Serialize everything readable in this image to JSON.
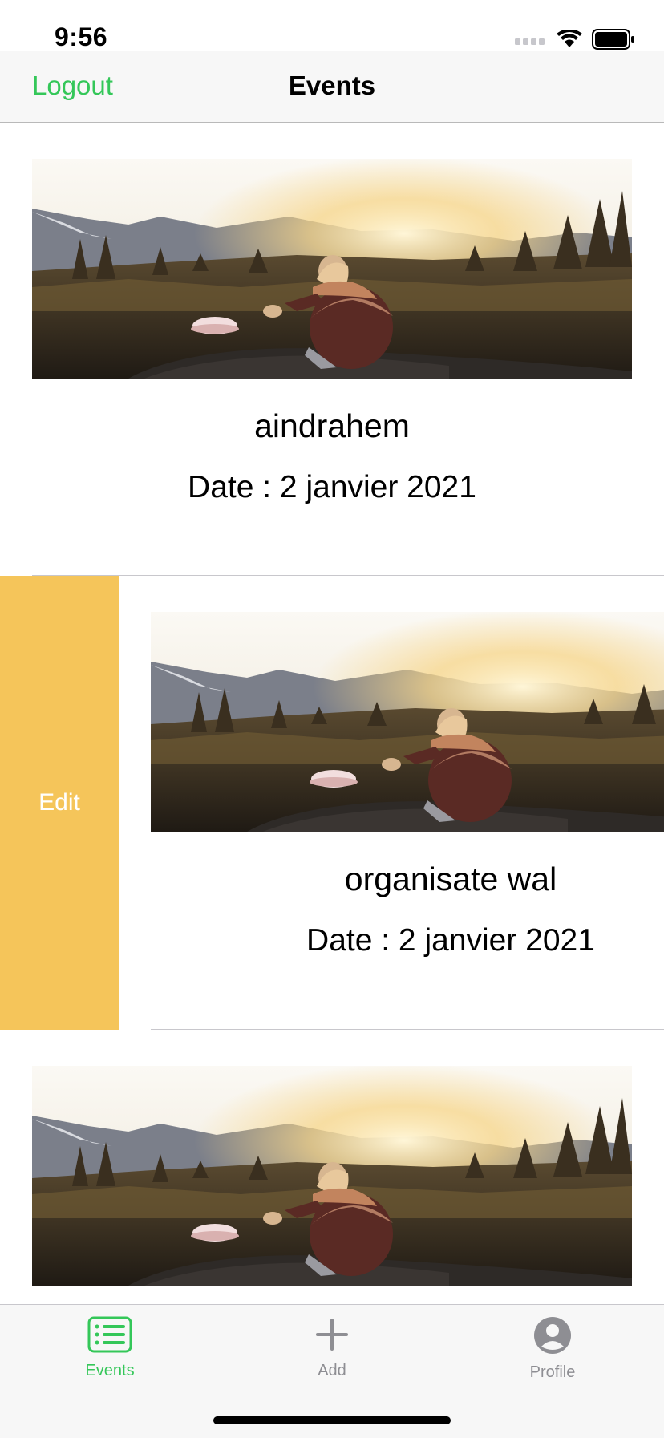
{
  "status": {
    "time": "9:56"
  },
  "nav": {
    "left_button": "Logout",
    "title": "Events"
  },
  "events": [
    {
      "title": "aindrahem",
      "date": "Date : 2 janvier 2021",
      "image": "sunset-landscape-photo"
    },
    {
      "title": "organisate wal",
      "date": "Date : 2 janvier 2021",
      "image": "sunset-landscape-photo",
      "swipe_action": "Edit"
    },
    {
      "title": "",
      "date": "",
      "image": "sunset-landscape-photo"
    }
  ],
  "tabs": [
    {
      "label": "Events",
      "icon": "list-icon",
      "selected": true
    },
    {
      "label": "Add",
      "icon": "plus-icon",
      "selected": false
    },
    {
      "label": "Profile",
      "icon": "person-circle-icon",
      "selected": false
    }
  ],
  "colors": {
    "accent": "#34c759",
    "edit_action": "#f5c55a",
    "inactive_tab": "#8e8e93"
  }
}
